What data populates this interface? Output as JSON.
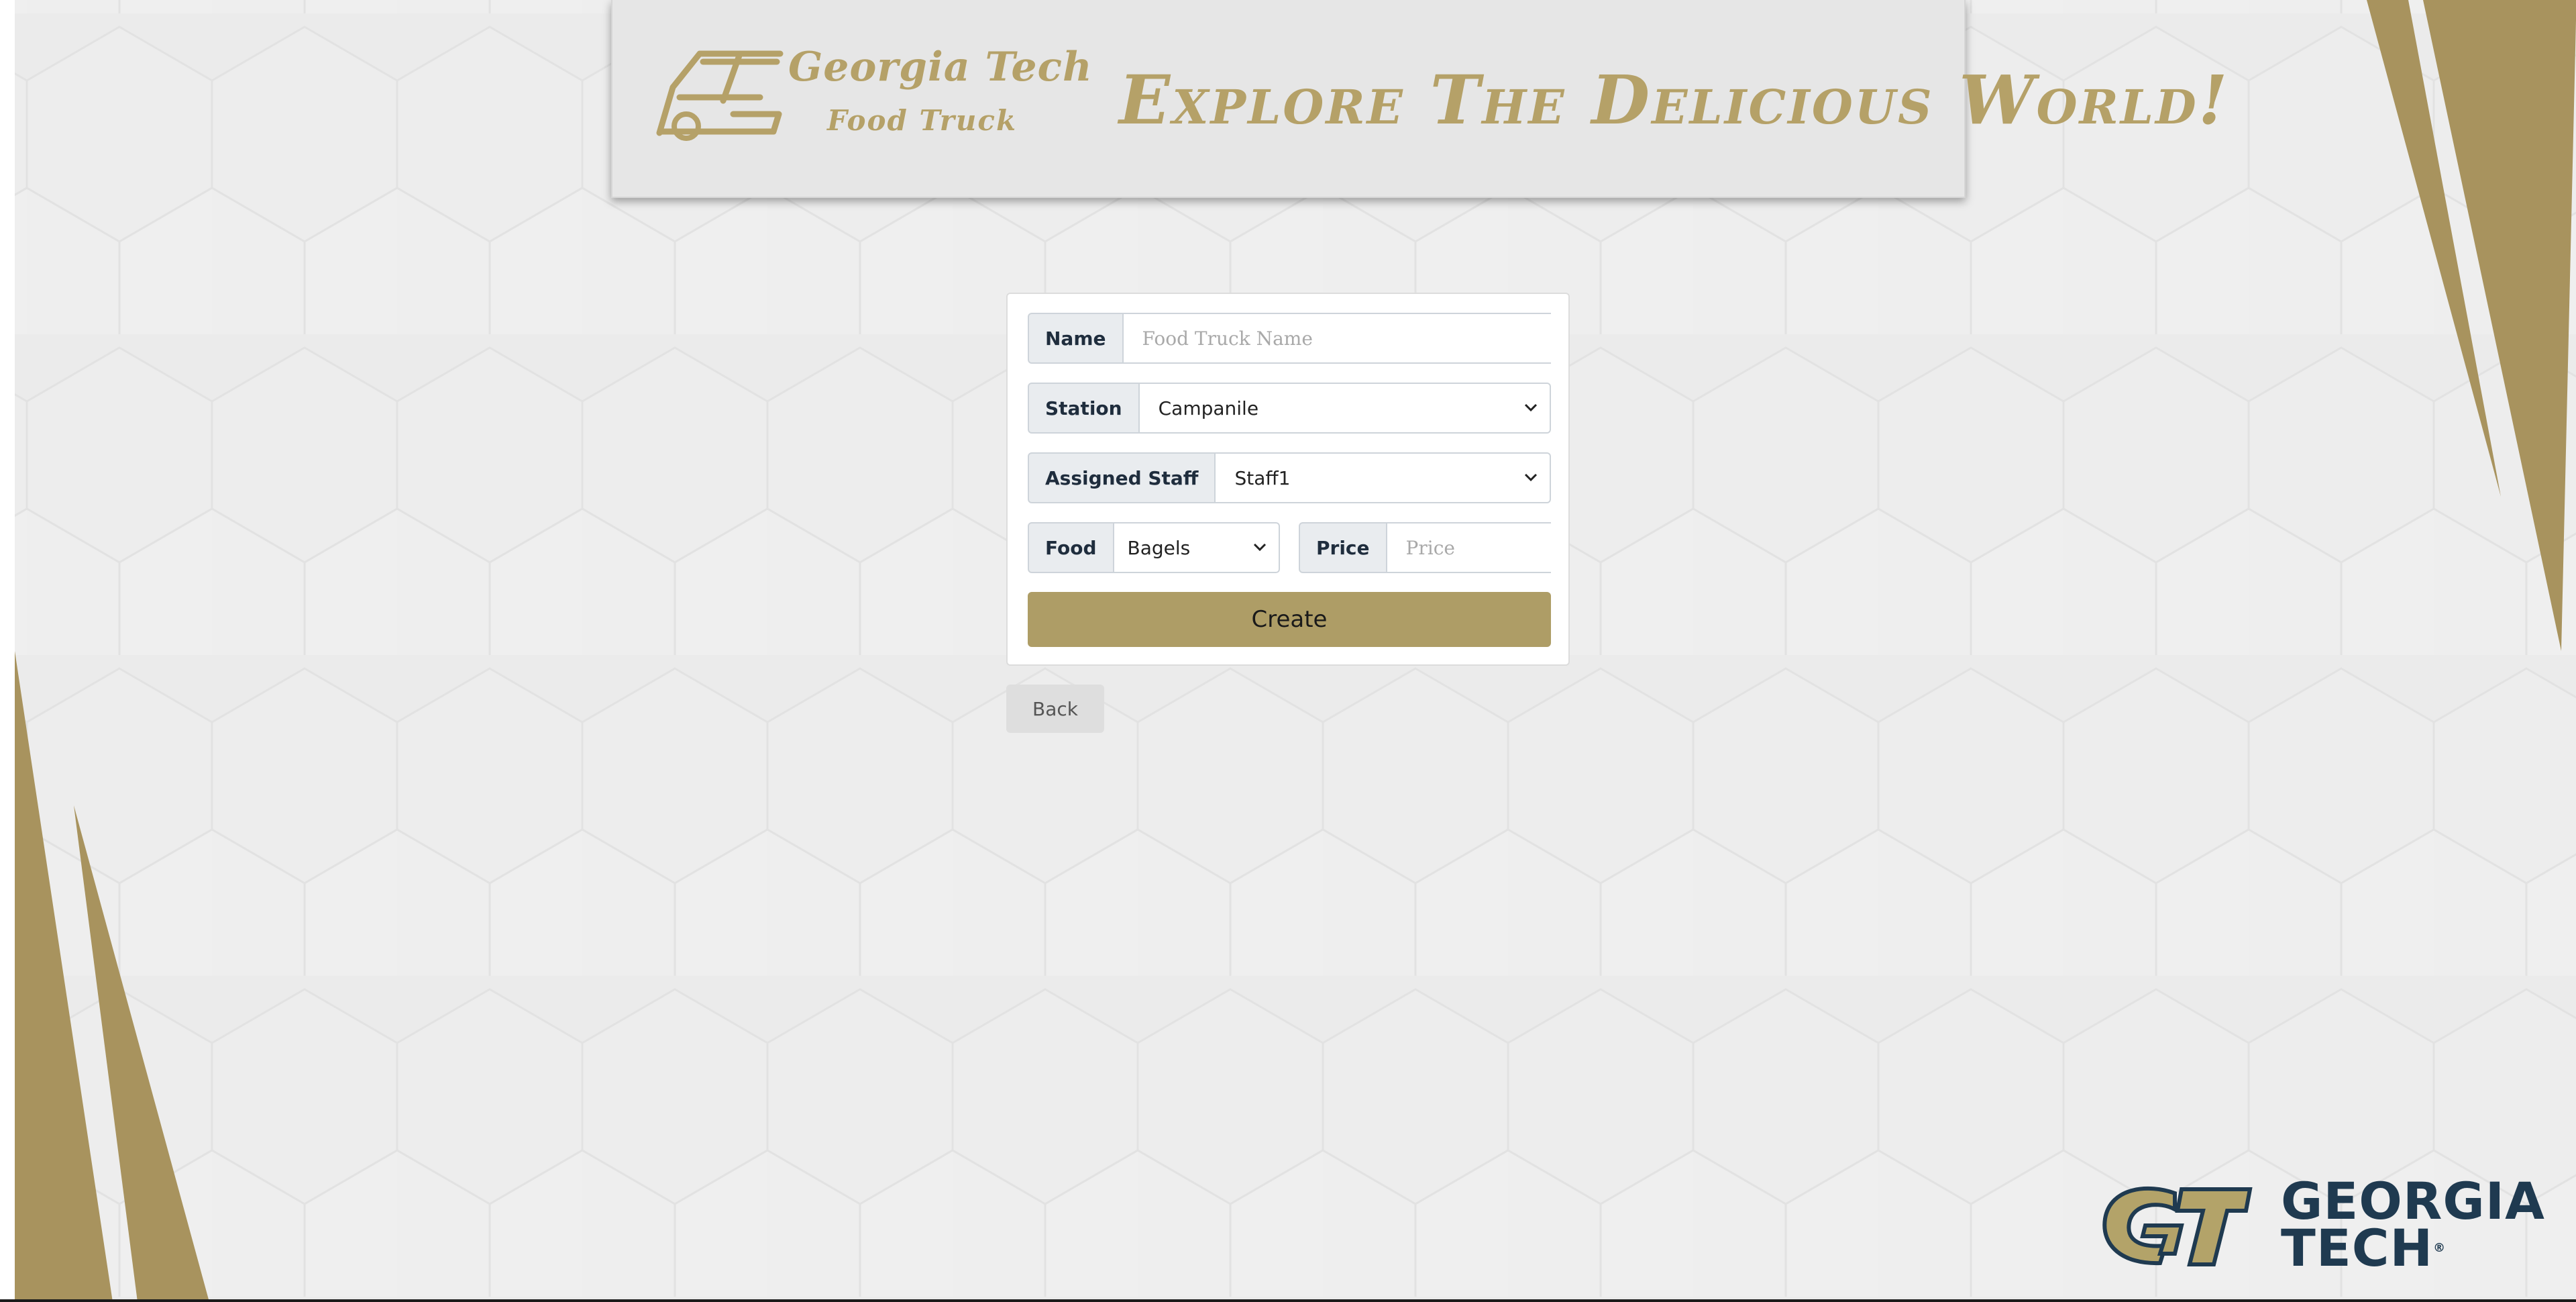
{
  "header": {
    "logo_line1": "Georgia Tech",
    "logo_line2": "Food Truck",
    "slogan": "Explore The Delicious World!"
  },
  "form": {
    "name": {
      "label": "Name",
      "placeholder": "Food Truck Name",
      "value": ""
    },
    "station": {
      "label": "Station",
      "value": "Campanile"
    },
    "staff": {
      "label": "Assigned Staff",
      "value": "Staff1"
    },
    "food": {
      "label": "Food",
      "value": "Bagels"
    },
    "price": {
      "label": "Price",
      "placeholder": "Price",
      "value": ""
    },
    "create_label": "Create"
  },
  "back_label": "Back",
  "footer_logo": {
    "line1": "GEORGIA",
    "line2": "TECH"
  },
  "colors": {
    "gold": "#b3a369",
    "navy": "#1f3a50",
    "background": "#ececec"
  },
  "icons": [
    "truck-logo-icon",
    "chevron-down-icon",
    "gt-logo-icon"
  ]
}
